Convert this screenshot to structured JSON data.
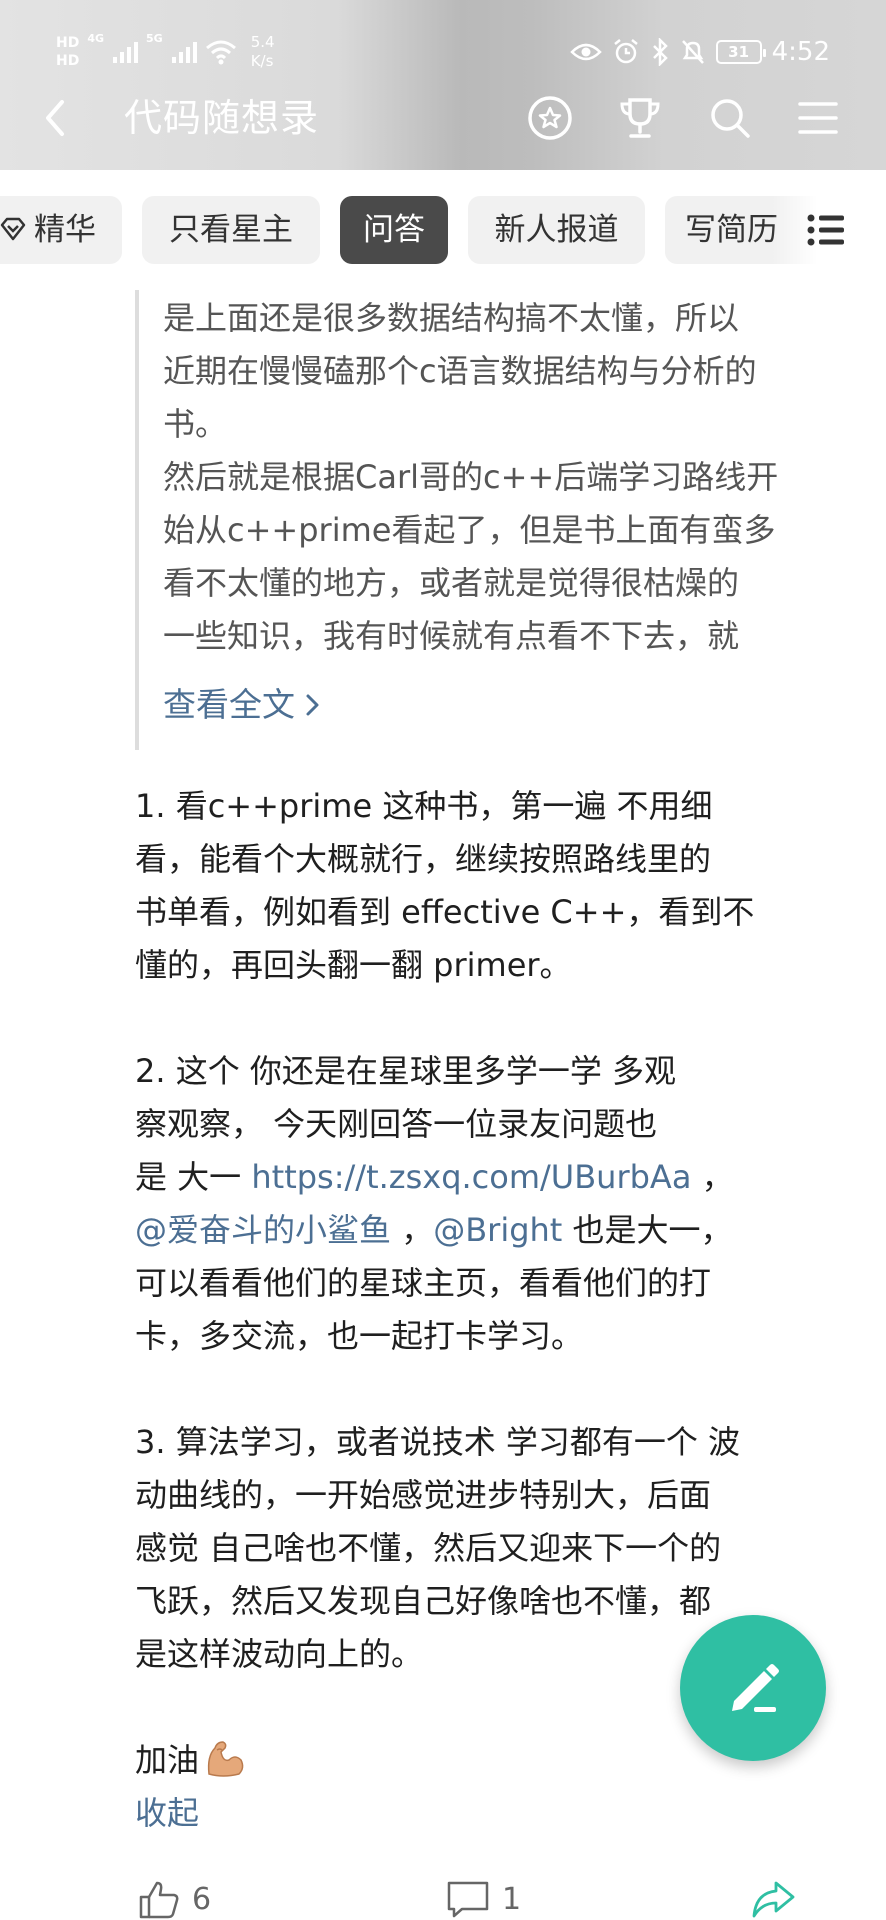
{
  "status_bar": {
    "hd_top": "HD",
    "hd_bottom": "HD",
    "sim1": "4G",
    "sim2": "5G",
    "speed_value": "5.4",
    "speed_unit": "K/s",
    "battery": "31",
    "time": "4:52"
  },
  "nav": {
    "title": "代码随想录"
  },
  "tabs": [
    {
      "label": "精华",
      "active": false
    },
    {
      "label": "只看星主",
      "active": false
    },
    {
      "label": "问答",
      "active": true
    },
    {
      "label": "新人报道",
      "active": false
    },
    {
      "label": "写简历",
      "active": false
    }
  ],
  "question": {
    "text": "是上面还是很多数据结构搞不太懂，所以\n近期在慢慢磕那个c语言数据结构与分析的\n书。\n然后就是根据Carl哥的c++后端学习路线开\n始从c++prime看起了，但是书上面有蛮多\n看不太懂的地方，或者就是觉得很枯燥的\n一些知识，我有时候就有点看不下去，就",
    "read_more": "查看全文"
  },
  "answer": {
    "p1": "1. 看c++prime 这种书，第一遍 不用细\n看，能看个大概就行，继续按照路线里的\n书单看，例如看到 effective C++，看到不\n懂的，再回头翻一翻 primer。",
    "p2_a": "2. 这个 你还是在星球里多学一学 多观\n察观察， 今天刚回答一位录友问题也\n是 大一 ",
    "p2_link": "https://t.zsxq.com/UBurbAa",
    "p2_b": " ，\n",
    "p2_mention1": "@爱奋斗的小鲨鱼",
    "p2_c": " ，",
    "p2_mention2": "@Bright",
    "p2_d": "  也是大一，\n可以看看他们的星球主页，看看他们的打\n卡，多交流，也一起打卡学习。",
    "p3": "3. 算法学习，或者说技术 学习都有一个 波\n动曲线的，一开始感觉进步特别大，后面\n感觉 自己啥也不懂，然后又迎来下一个的\n飞跃，然后又发现自己好像啥也不懂，都\n是这样波动向上的。",
    "p4": "加油",
    "collapse": "收起"
  },
  "actions": {
    "likes": "6",
    "comments": "1"
  },
  "colors": {
    "accent": "#2fbfa3",
    "link": "#4c6f93",
    "active_tab": "#4a4a4a"
  },
  "icons": [
    "back-icon",
    "star-badge-icon",
    "trophy-icon",
    "search-icon",
    "menu-icon",
    "list-icon",
    "like-icon",
    "comment-icon",
    "share-icon",
    "edit-icon",
    "flexed-biceps-icon"
  ]
}
